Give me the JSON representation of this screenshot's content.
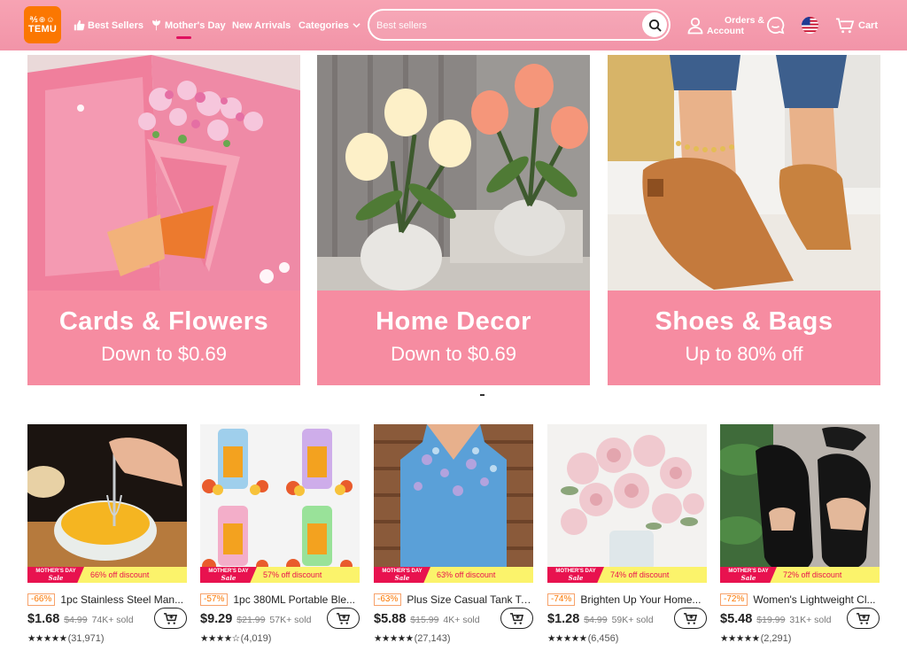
{
  "header": {
    "logo_glyphs": "℁⊕☺",
    "logo_text": "TEMU",
    "nav": [
      {
        "label": "Best Sellers",
        "icon": "thumbs-up-icon"
      },
      {
        "label": "Mother's Day",
        "icon": "flower-icon",
        "active": true
      },
      {
        "label": "New Arrivals",
        "icon": ""
      },
      {
        "label": "Categories",
        "icon": "chevron-down-icon"
      }
    ],
    "search_placeholder": "Best sellers",
    "orders_line1": "Orders &",
    "orders_line2": "Account",
    "cart_label": "Cart",
    "colors": {
      "bar": "#f294a8",
      "brand": "#fb7701",
      "accent": "#e0115f"
    }
  },
  "banners": [
    {
      "title": "Cards & Flowers",
      "subtitle": "Down to $0.69"
    },
    {
      "title": "Home Decor",
      "subtitle": "Down to $0.69"
    },
    {
      "title": "Shoes & Bags",
      "subtitle": "Up to 80% off"
    }
  ],
  "promo_tag_line1": "MOTHER'S DAY",
  "promo_tag_line2": "Sale",
  "products": [
    {
      "discount": "-66%",
      "title": "1pc Stainless Steel Man...",
      "price": "$1.68",
      "was": "$4.99",
      "sold": "74K+ sold",
      "rating": 5,
      "reviews": "(31,971)",
      "promo": "66% off discount"
    },
    {
      "discount": "-57%",
      "title": "1pc 380ML Portable Ble...",
      "price": "$9.29",
      "was": "$21.99",
      "sold": "57K+ sold",
      "rating": 4,
      "reviews": "(4,019)",
      "promo": "57% off discount"
    },
    {
      "discount": "-63%",
      "title": "Plus Size Casual Tank To...",
      "price": "$5.88",
      "was": "$15.99",
      "sold": "4K+ sold",
      "rating": 5,
      "reviews": "(27,143)",
      "promo": "63% off discount"
    },
    {
      "discount": "-74%",
      "title": "Brighten Up Your Home...",
      "price": "$1.28",
      "was": "$4.99",
      "sold": "59K+ sold",
      "rating": 5,
      "reviews": "(6,456)",
      "promo": "74% off discount"
    },
    {
      "discount": "-72%",
      "title": "Women's Lightweight Cl...",
      "price": "$5.48",
      "was": "$19.99",
      "sold": "31K+ sold",
      "rating": 5,
      "reviews": "(2,291)",
      "promo": "72% off discount"
    }
  ]
}
